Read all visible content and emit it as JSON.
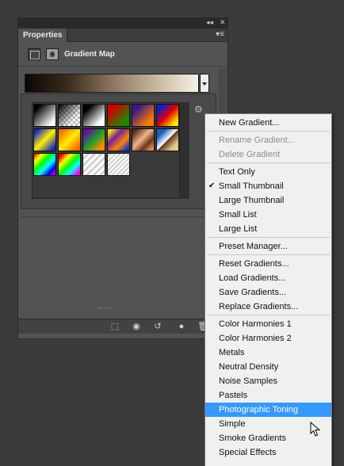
{
  "panel": {
    "tab_label": "Properties",
    "menu_glyph": "▾≡",
    "title": "Gradient Map",
    "collapse_glyph": "◂◂",
    "close_glyph": "✕",
    "gear_glyph": "⚙"
  },
  "gradient_bar": {
    "colors": [
      "#0b0704",
      "#3b2c1d",
      "#8a7560",
      "#c6b69c",
      "#f7f1e6"
    ]
  },
  "swatches": [
    {
      "name": "foreground-to-background",
      "css": "linear-gradient(135deg,#000 15%,#fff 85%)"
    },
    {
      "name": "foreground-to-transparent",
      "css": "linear-gradient(135deg,#000 0%,rgba(0,0,0,0) 70%)"
    },
    {
      "name": "black-white",
      "css": "linear-gradient(135deg,#000 20%,#fff 80%)"
    },
    {
      "name": "red-green",
      "css": "linear-gradient(135deg,#d10000 20%,#1b8c00 80%)"
    },
    {
      "name": "violet-orange",
      "css": "linear-gradient(135deg,#3a1a8a 20%,#ff7a00 80%)"
    },
    {
      "name": "blue-red-yellow",
      "css": "linear-gradient(135deg,#0a1fd0 15%,#e00000 50%,#ffe400 85%)"
    },
    {
      "name": "blue-yellow-blue",
      "css": "linear-gradient(135deg,#1626c8 10%,#ffef00 50%,#1626c8 90%)"
    },
    {
      "name": "orange-yellow-orange",
      "css": "linear-gradient(135deg,#ff6a00 10%,#ffee00 50%,#ff6a00 90%)"
    },
    {
      "name": "violet-green-orange",
      "css": "linear-gradient(135deg,#6a0fa8 15%,#17a02a 50%,#ff8a00 85%)"
    },
    {
      "name": "yellow-violet-orange-blue",
      "css": "linear-gradient(135deg,#f5e100 10%,#7a1fa0 35%,#ff8400 65%,#1b3fcf 90%)"
    },
    {
      "name": "copper",
      "css": "linear-gradient(135deg,#5a2a12 10%,#f2b48a 45%,#6b3518 70%,#d98b5c 90%)"
    },
    {
      "name": "chrome",
      "css": "linear-gradient(135deg,#1a5fc0 20%,#ffffff 48%,#5a3a1a 52%,#e8c890 80%)"
    },
    {
      "name": "spectrum",
      "css": "linear-gradient(135deg,#ff0000,#ffff00,#00ff00,#00ffff,#0000ff,#ff00ff)"
    },
    {
      "name": "transparent-rainbow",
      "css": "linear-gradient(135deg,#ff0000 10%,#ffff00 30%,#00ff00 50%,#00ffff 70%,#ff00ff 90%)"
    },
    {
      "name": "transparent-stripes",
      "css": "repeating-linear-gradient(135deg,#ffffff 0 3px,#d0d0d0 3px 6px)"
    },
    {
      "name": "neutral-density",
      "css": "repeating-linear-gradient(135deg,#ffffff 0 2px,#cfcfcf 2px 4px)"
    }
  ],
  "footer": {
    "clip_glyph": "⬚",
    "view_prev_glyph": "◉",
    "reset_glyph": "↺",
    "visibility_glyph": "●",
    "delete_glyph": "🗑"
  },
  "menu": {
    "groups": [
      [
        {
          "label": "New Gradient...",
          "disabled": false,
          "checked": false,
          "highlighted": false
        }
      ],
      [
        {
          "label": "Rename Gradient...",
          "disabled": true,
          "checked": false,
          "highlighted": false
        },
        {
          "label": "Delete Gradient",
          "disabled": true,
          "checked": false,
          "highlighted": false
        }
      ],
      [
        {
          "label": "Text Only",
          "disabled": false,
          "checked": false,
          "highlighted": false
        },
        {
          "label": "Small Thumbnail",
          "disabled": false,
          "checked": true,
          "highlighted": false
        },
        {
          "label": "Large Thumbnail",
          "disabled": false,
          "checked": false,
          "highlighted": false
        },
        {
          "label": "Small List",
          "disabled": false,
          "checked": false,
          "highlighted": false
        },
        {
          "label": "Large List",
          "disabled": false,
          "checked": false,
          "highlighted": false
        }
      ],
      [
        {
          "label": "Preset Manager...",
          "disabled": false,
          "checked": false,
          "highlighted": false
        }
      ],
      [
        {
          "label": "Reset Gradients...",
          "disabled": false,
          "checked": false,
          "highlighted": false
        },
        {
          "label": "Load Gradients...",
          "disabled": false,
          "checked": false,
          "highlighted": false
        },
        {
          "label": "Save Gradients...",
          "disabled": false,
          "checked": false,
          "highlighted": false
        },
        {
          "label": "Replace Gradients...",
          "disabled": false,
          "checked": false,
          "highlighted": false
        }
      ],
      [
        {
          "label": "Color Harmonies 1",
          "disabled": false,
          "checked": false,
          "highlighted": false
        },
        {
          "label": "Color Harmonies 2",
          "disabled": false,
          "checked": false,
          "highlighted": false
        },
        {
          "label": "Metals",
          "disabled": false,
          "checked": false,
          "highlighted": false
        },
        {
          "label": "Neutral Density",
          "disabled": false,
          "checked": false,
          "highlighted": false
        },
        {
          "label": "Noise Samples",
          "disabled": false,
          "checked": false,
          "highlighted": false
        },
        {
          "label": "Pastels",
          "disabled": false,
          "checked": false,
          "highlighted": false
        },
        {
          "label": "Photographic Toning",
          "disabled": false,
          "checked": false,
          "highlighted": true
        },
        {
          "label": "Simple",
          "disabled": false,
          "checked": false,
          "highlighted": false
        },
        {
          "label": "Smoke Gradients",
          "disabled": false,
          "checked": false,
          "highlighted": false
        },
        {
          "label": "Special Effects",
          "disabled": false,
          "checked": false,
          "highlighted": false
        }
      ]
    ],
    "check_glyph": "✔",
    "highlight_color": "#3399ff"
  }
}
